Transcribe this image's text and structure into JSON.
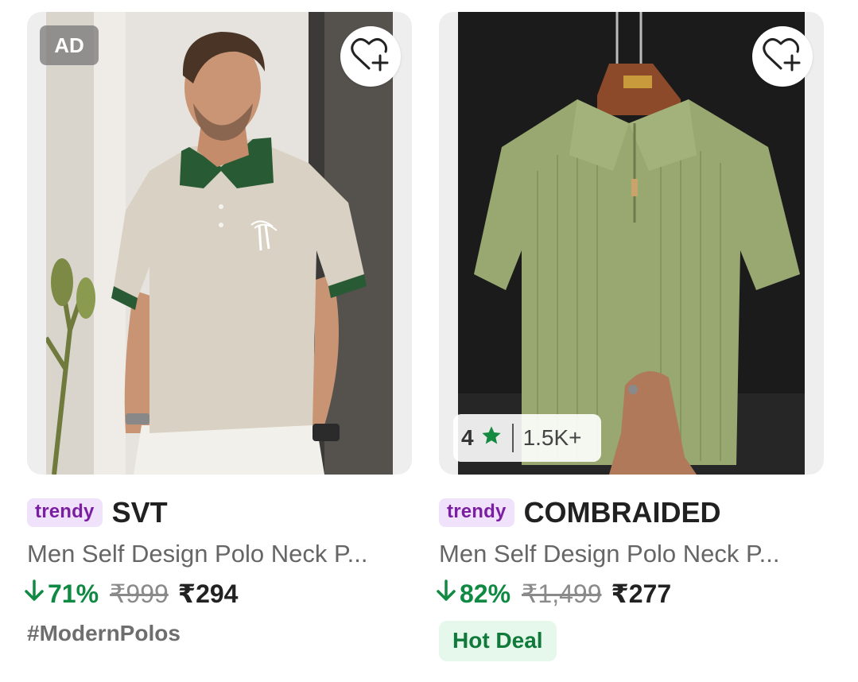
{
  "products": [
    {
      "ad_label": "AD",
      "wishlist_icon": "heart-plus-icon",
      "tag": "trendy",
      "brand": "SVT",
      "title": "Men Self Design Polo Neck P...",
      "discount": "71%",
      "mrp": "₹999",
      "price": "₹294",
      "extra_label": "#ModernPolos",
      "colors": {
        "shirt": "#d8d0c2",
        "collar": "#285a34",
        "background": "#e4e1dc"
      }
    },
    {
      "wishlist_icon": "heart-plus-icon",
      "rating": "4",
      "rating_count": "1.5K+",
      "tag": "trendy",
      "brand": "COMBRAIDED",
      "title": "Men Self Design Polo Neck P...",
      "discount": "82%",
      "mrp": "₹1,499",
      "price": "₹277",
      "extra_label": "Hot Deal",
      "colors": {
        "shirt": "#98a870",
        "hanger": "#8a4a2a",
        "background": "#1a1a1a"
      }
    }
  ],
  "theme": {
    "discount_green": "#108a43",
    "trendy_bg": "#f1e2fb",
    "trendy_text": "#7b1fa2",
    "star_green": "#138a3f"
  }
}
